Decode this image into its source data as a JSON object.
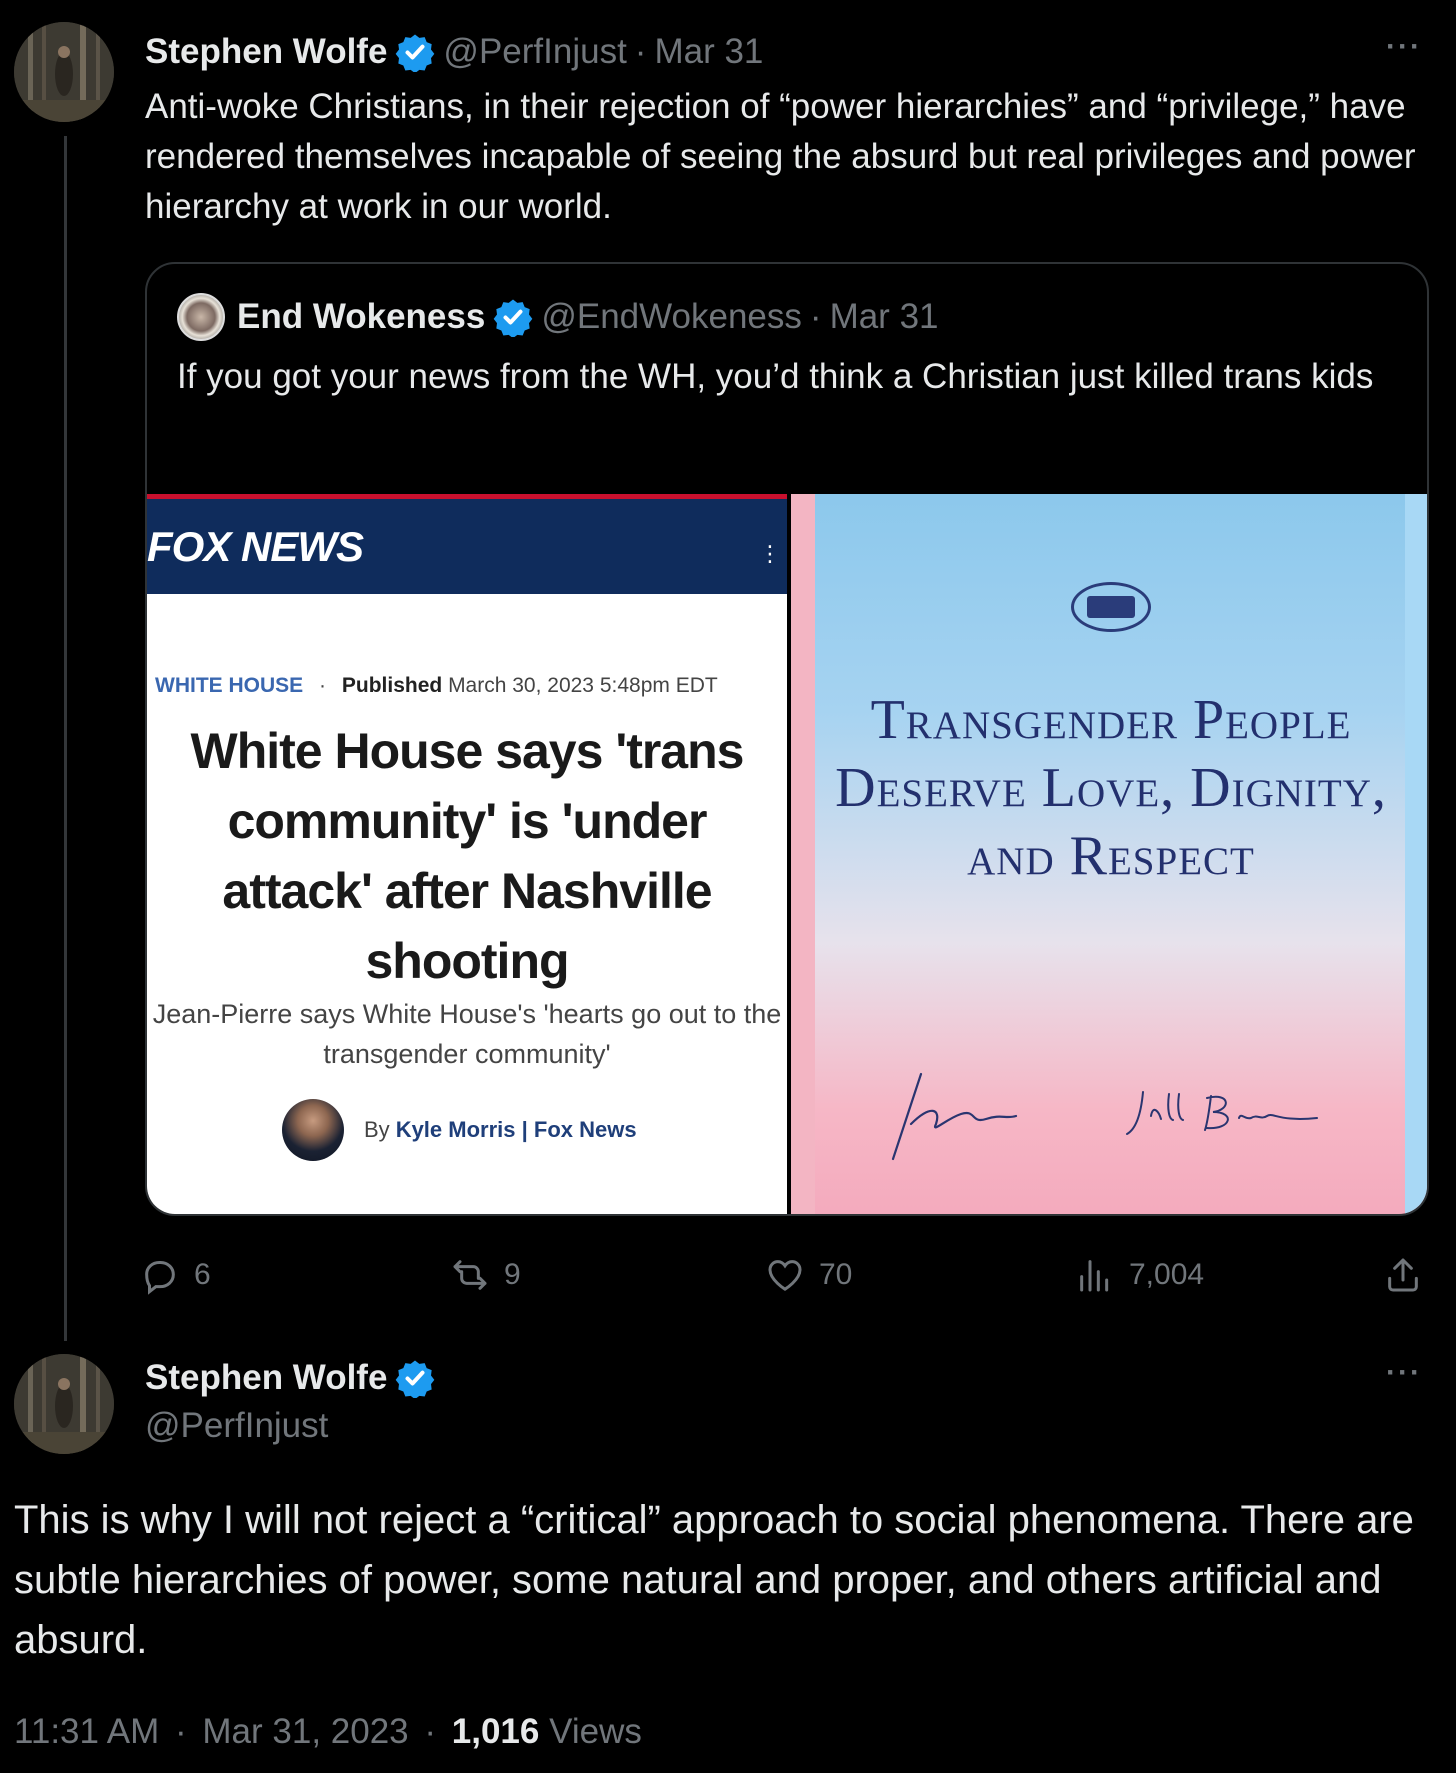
{
  "tweet1": {
    "author_name": "Stephen Wolfe",
    "handle": "@PerfInjust",
    "separator": "·",
    "date": "Mar 31",
    "more": "···",
    "text": "Anti-woke Christians, in their rejection of “power hierarchies” and “privilege,” have rendered themselves incapable of seeing the absurd but real privileges and power hierarchy at work in our world."
  },
  "quote": {
    "author_name": "End Wokeness",
    "handle": "@EndWokeness",
    "separator": "·",
    "date": "Mar 31",
    "text": "If you got your news from the WH, you’d think a Christian just killed trans kids"
  },
  "media_left": {
    "logo": "FOX NEWS",
    "menu": "⋮",
    "category": "WHITE HOUSE",
    "bullet": "·",
    "published_label": "Published",
    "published_date": "March 30, 2023 5:48pm EDT",
    "headline": "White House says 'trans community' is 'under attack' after Nashville shooting",
    "subhead": "Jean-Pierre says White House's 'hearts go out to the transgender community'",
    "byline_prefix": "By",
    "byline_author": "Kyle Morris | Fox News"
  },
  "media_right": {
    "message": "Transgender People Deserve Love, Dignity, and Respect"
  },
  "actions": {
    "replies": "6",
    "reposts": "9",
    "likes": "70",
    "views": "7,004"
  },
  "tweet2": {
    "author_name": "Stephen Wolfe",
    "handle": "@PerfInjust",
    "more": "···",
    "text": "This is why I will not reject a “critical” approach to social phenomena. There are subtle hierarchies of power, some natural and proper, and others artificial and absurd.",
    "time": "11:31 AM",
    "separator": "·",
    "date": "Mar 31, 2023",
    "views_count": "1,016",
    "views_label": "Views"
  },
  "colors": {
    "background": "#000000",
    "text": "#e7e9ea",
    "muted": "#71767b",
    "verified": "#1d9bf0",
    "border": "#2f3336"
  },
  "icons": [
    "verified-badge-icon",
    "more-icon",
    "reply-icon",
    "repost-icon",
    "like-icon",
    "views-icon",
    "share-icon",
    "white-house-seal-icon"
  ]
}
